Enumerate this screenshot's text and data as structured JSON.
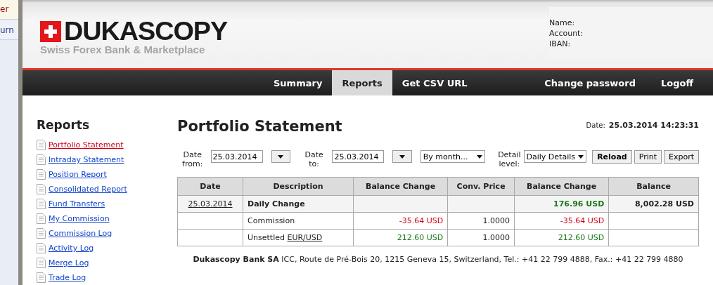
{
  "background_window": {
    "items": [
      {
        "label": "er",
        "kind": "selected"
      },
      {
        "label": "urn",
        "kind": "plain"
      }
    ]
  },
  "header": {
    "logo": {
      "name": "DUKASCOPY",
      "tagline": "Swiss Forex Bank & Marketplace"
    },
    "account_fields": [
      {
        "label": "Name:"
      },
      {
        "label": "Account:"
      },
      {
        "label": "IBAN:"
      }
    ]
  },
  "nav": {
    "left": [
      {
        "label": "Summary",
        "selected": false
      },
      {
        "label": "Reports",
        "selected": true
      },
      {
        "label": "Get CSV URL",
        "selected": false
      }
    ],
    "right": [
      {
        "label": "Change password",
        "selected": false
      },
      {
        "label": "Logoff",
        "selected": false
      }
    ]
  },
  "sidebar": {
    "title": "Reports",
    "items": [
      {
        "label": "Portfolio Statement",
        "selected": true
      },
      {
        "label": "Intraday Statement",
        "selected": false
      },
      {
        "label": "Position Report",
        "selected": false
      },
      {
        "label": "Consolidated Report",
        "selected": false
      },
      {
        "label": "Fund Transfers",
        "selected": false
      },
      {
        "label": "My Commission",
        "selected": false
      },
      {
        "label": "Commission Log",
        "selected": false
      },
      {
        "label": "Activity Log",
        "selected": false
      },
      {
        "label": "Merge Log",
        "selected": false
      },
      {
        "label": "Trade Log",
        "selected": false
      }
    ]
  },
  "page": {
    "title": "Portfolio Statement",
    "date_label": "Date:",
    "date_value": "25.03.2014 14:23:31"
  },
  "filters": {
    "date_from": {
      "label": "Date from:",
      "value": "25.03.2014"
    },
    "date_to": {
      "label": "Date to:",
      "value": "25.03.2014"
    },
    "period": {
      "value": "By month..."
    },
    "detail_level": {
      "label": "Detail level:",
      "value": "Daily Details"
    },
    "buttons": [
      {
        "label": "Reload",
        "kind": "primary"
      },
      {
        "label": "Print",
        "kind": "plain"
      },
      {
        "label": "Export",
        "kind": "plain"
      }
    ]
  },
  "table": {
    "columns": [
      "Date",
      "Description",
      "Balance Change",
      "Conv. Price",
      "Balance Change",
      "Balance"
    ],
    "rows": [
      {
        "kind": "summary",
        "date": "25.03.2014",
        "description": "Daily Change",
        "balance_change_2": {
          "text": "176.96 USD",
          "color": "#1a7a1a"
        },
        "balance": "8,002.28 USD"
      },
      {
        "kind": "detail",
        "description": "Commission",
        "balance_change_1": {
          "text": "-35.64 USD",
          "color": "#d0021b"
        },
        "conv_price": "1.0000",
        "balance_change_2": {
          "text": "-35.64 USD",
          "color": "#d0021b"
        }
      },
      {
        "kind": "detail",
        "description": "Unsettled",
        "description_link": "EUR/USD",
        "balance_change_1": {
          "text": "212.60 USD",
          "color": "#1a7a1a"
        },
        "conv_price": "1.0000",
        "balance_change_2": {
          "text": "212.60 USD",
          "color": "#1a7a1a"
        }
      }
    ]
  },
  "footer": {
    "text": "**Dukascopy Bank SA** ICC, Route de Pré-Bois 20, 1215 Geneva 15, Switzerland, Tel.: +41 22 799 4888, Fax.: +41 22 799 4880"
  }
}
